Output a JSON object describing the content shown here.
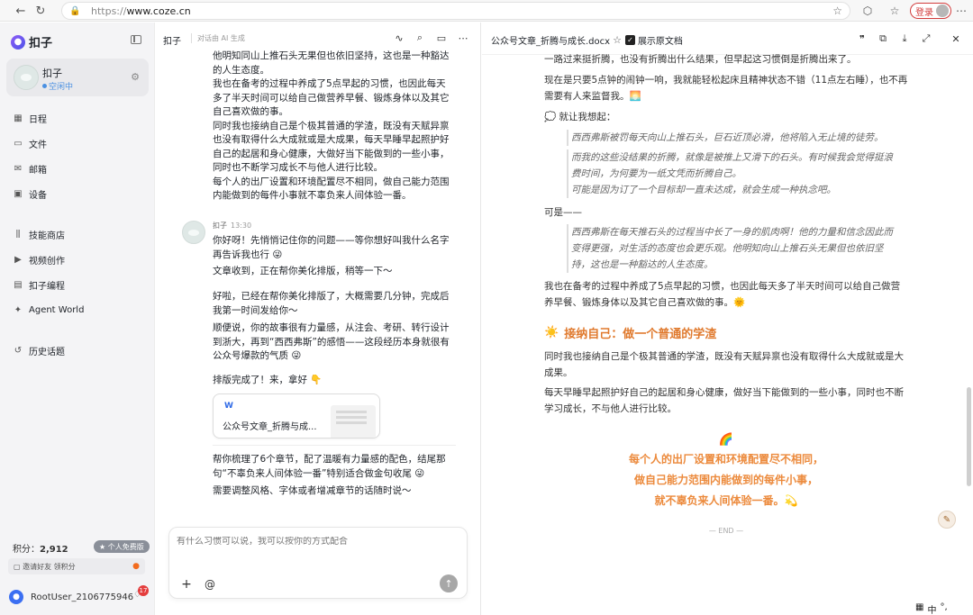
{
  "browser": {
    "url_proto": "https://",
    "url_host": "www.coze.cn",
    "login_label": "登录"
  },
  "sidebar": {
    "brand": "扣子",
    "bot_name": "扣子",
    "bot_status": "空闲中",
    "nav_main": [
      {
        "label": "日程",
        "icon": "calendar-icon"
      },
      {
        "label": "文件",
        "icon": "folder-icon"
      },
      {
        "label": "邮箱",
        "icon": "mail-icon"
      },
      {
        "label": "设备",
        "icon": "device-icon"
      }
    ],
    "nav_tools": [
      {
        "label": "技能商店",
        "icon": "skills-icon"
      },
      {
        "label": "视频创作",
        "icon": "video-icon"
      },
      {
        "label": "扣子编程",
        "icon": "code-icon"
      },
      {
        "label": "Agent World",
        "icon": "globe-icon"
      }
    ],
    "history_label": "历史话题",
    "points_label": "积分：",
    "points_value": "2,912",
    "plan_badge": "个人免费版",
    "invite_label": "邀请好友 领积分",
    "username": "RootUser_2106775946",
    "notification_count": "17"
  },
  "chat": {
    "title": "扣子",
    "subtitle": "对话由 AI 生成",
    "prev_message_lines": [
      "他明知同山上推石头无果但也依旧坚持，这也是一种豁达",
      "的人生态度。",
      "我也在备考的过程中养成了5点早起的习惯，也因此每天",
      "多了半天时间可以给自己做营养早餐、锻炼身体以及其它",
      "自己喜欢做的事。",
      "同时我也接纳自己是个极其普通的学渣，既没有天赋异禀",
      "也没有取得什么大成就或是大成果，每天早睡早起照护好",
      "自己的起居和身心健康，大做好当下能做到的一些小事，",
      "同时也不断学习成长不与他人进行比较。",
      "每个人的出厂设置和环境配置尽不相同，做自己能力范围",
      "内能做到的每件小事就不辜负来人间体验一番。"
    ],
    "bot_name": "扣子",
    "bot_time": "13:30",
    "messages": [
      "你好呀！先悄悄记住你的问题——等你想好叫我什么名字再告诉我也行 😜",
      "文章收到，正在帮你美化排版，稍等一下～",
      "好啦，已经在帮你美化排版了，大概需要几分钟，完成后我第一时间发给你～",
      "顺便说，你的故事很有力量感，从注会、考研、转行设计到浙大，再到“西西弗斯”的感悟——这段经历本身就很有公众号爆款的气质 😜",
      "排版完成了！来，拿好 👇"
    ],
    "file_card_name": "公众号文章_折腾与成...",
    "summary_lines": [
      "帮你梳理了6个章节，配了温暖有力量感的配色，结尾那句“不辜负来人间体验一番”特别适合做金句收尾 😜",
      "需要调整风格、字体或者增减章节的话随时说～"
    ],
    "input_placeholder": "有什么习惯可以说，我可以按你的方式配合"
  },
  "doc": {
    "title": "公众号文章_折腾与成长.docx",
    "show_original": "展示原文档",
    "p1": "一路过来挺折腾，也没有折腾出什么结果，但早起这习惯倒是折腾出来了。",
    "p2": "现在是只要5点钟的闹钟一响，我就能轻松起床且精神状态不错（11点左右睡），也不再需要有人来监督我。🌅",
    "think_label": "💭 就让我想起：",
    "quote1_a": "西西弗斯被罚每天向山上推石头，巨石近顶必滑，他将陷入无止境的徒劳。",
    "quote1_b": "而我的这些没结果的折腾，就像是被推上又滑下的石头。有时候我会觉得挺浪费时间，为何要为一纸文凭而折腾自己。",
    "quote1_c": "可能是因为订了一个目标却一直未达成，就会生成一种执念吧。",
    "but_label": "可是——",
    "quote2": "西西弗斯在每天推石头的过程当中长了一身的肌肉啊！他的力量和信念因此而变得更强，对生活的态度也会更乐观。他明知向山上推石头无果但也依旧坚持，这也是一种豁达的人生态度。",
    "p3": "我也在备考的过程中养成了5点早起的习惯，也因此每天多了半天时间可以给自己做营养早餐、锻炼身体以及其它自己喜欢做的事。🌞",
    "section_title": "接纳自己：做一个普通的学渣",
    "section_icon": "☀️",
    "p4": "同时我也接纳自己是个极其普通的学渣，既没有天赋异禀也没有取得什么大成就或是大成果。",
    "p5": "每天早睡早起照护好自己的起居和身心健康，做好当下能做到的一些小事，同时也不断学习成长，不与他人进行比较。",
    "rainbow": "🌈",
    "closing_lines": [
      "每个人的出厂设置和环境配置尽不相同，",
      "做自己能力范围内能做到的每件小事，",
      "就不辜负来人间体验一番。💫"
    ],
    "end_mark": "— END —"
  },
  "ime": {
    "mode": "中"
  },
  "colors": {
    "accent_orange": "#e07a2e",
    "closing_orange": "#ec8a3c",
    "brand_purple": "#6f58f0"
  }
}
